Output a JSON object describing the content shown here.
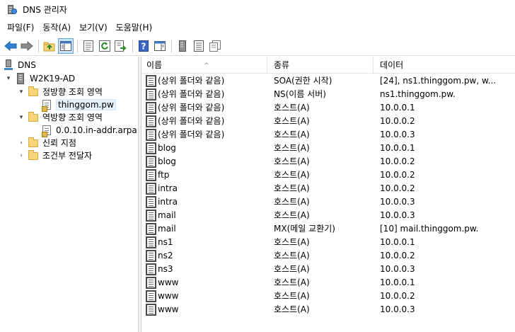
{
  "window": {
    "title": "DNS 관리자"
  },
  "menu": [
    {
      "label": "파일(F)"
    },
    {
      "label": "동작(A)"
    },
    {
      "label": "보기(V)"
    },
    {
      "label": "도움말(H)"
    }
  ],
  "toolbar": {
    "buttons": [
      {
        "icon": "back-arrow-icon"
      },
      {
        "icon": "forward-arrow-icon"
      },
      {
        "icon": "up-folder-icon"
      },
      {
        "icon": "show-hide-console-tree-icon"
      },
      {
        "icon": "properties-icon"
      },
      {
        "icon": "refresh-icon"
      },
      {
        "icon": "export-list-icon"
      },
      {
        "icon": "help-icon"
      },
      {
        "icon": "show-hide-action-pane-icon"
      },
      {
        "icon": "server-icon"
      },
      {
        "icon": "zone-list-icon"
      },
      {
        "icon": "copy-icon"
      }
    ]
  },
  "tree": {
    "items": [
      {
        "label": "DNS",
        "toggle": "",
        "icon": "dns-root-icon",
        "selected": false
      },
      {
        "label": "W2K19-AD",
        "toggle": "▾",
        "icon": "server-icon",
        "selected": false
      },
      {
        "label": "정방향 조회 영역",
        "toggle": "▾",
        "icon": "folder-icon",
        "selected": false
      },
      {
        "label": "thinggom.pw",
        "toggle": "",
        "icon": "zone-icon",
        "selected": true
      },
      {
        "label": "역방향 조회 영역",
        "toggle": "▾",
        "icon": "folder-icon",
        "selected": false
      },
      {
        "label": "0.0.10.in-addr.arpa",
        "toggle": "",
        "icon": "zone-icon",
        "selected": false
      },
      {
        "label": "신뢰 지점",
        "toggle": "›",
        "icon": "folder-icon",
        "selected": false
      },
      {
        "label": "조건부 전달자",
        "toggle": "›",
        "icon": "folder-icon",
        "selected": false
      }
    ]
  },
  "list": {
    "columns": [
      "이름",
      "종류",
      "데이터"
    ],
    "sort_indicator": "^",
    "rows": [
      {
        "name": "(상위 폴더와 같음)",
        "type": "SOA(권한 시작)",
        "data": "[24], ns1.thinggom.pw, w..."
      },
      {
        "name": "(상위 폴더와 같음)",
        "type": "NS(이름 서버)",
        "data": "ns1.thinggom.pw."
      },
      {
        "name": "(상위 폴더와 같음)",
        "type": "호스트(A)",
        "data": "10.0.0.1"
      },
      {
        "name": "(상위 폴더와 같음)",
        "type": "호스트(A)",
        "data": "10.0.0.2"
      },
      {
        "name": "(상위 폴더와 같음)",
        "type": "호스트(A)",
        "data": "10.0.0.3"
      },
      {
        "name": "blog",
        "type": "호스트(A)",
        "data": "10.0.0.1"
      },
      {
        "name": "blog",
        "type": "호스트(A)",
        "data": "10.0.0.2"
      },
      {
        "name": "ftp",
        "type": "호스트(A)",
        "data": "10.0.0.2"
      },
      {
        "name": "intra",
        "type": "호스트(A)",
        "data": "10.0.0.2"
      },
      {
        "name": "intra",
        "type": "호스트(A)",
        "data": "10.0.0.3"
      },
      {
        "name": "mail",
        "type": "호스트(A)",
        "data": "10.0.0.3"
      },
      {
        "name": "mail",
        "type": "MX(메일 교환기)",
        "data": "[10]  mail.thinggom.pw."
      },
      {
        "name": "ns1",
        "type": "호스트(A)",
        "data": "10.0.0.1"
      },
      {
        "name": "ns2",
        "type": "호스트(A)",
        "data": "10.0.0.2"
      },
      {
        "name": "ns3",
        "type": "호스트(A)",
        "data": "10.0.0.3"
      },
      {
        "name": "www",
        "type": "호스트(A)",
        "data": "10.0.0.1"
      },
      {
        "name": "www",
        "type": "호스트(A)",
        "data": "10.0.0.2"
      },
      {
        "name": "www",
        "type": "호스트(A)",
        "data": "10.0.0.3"
      }
    ]
  }
}
